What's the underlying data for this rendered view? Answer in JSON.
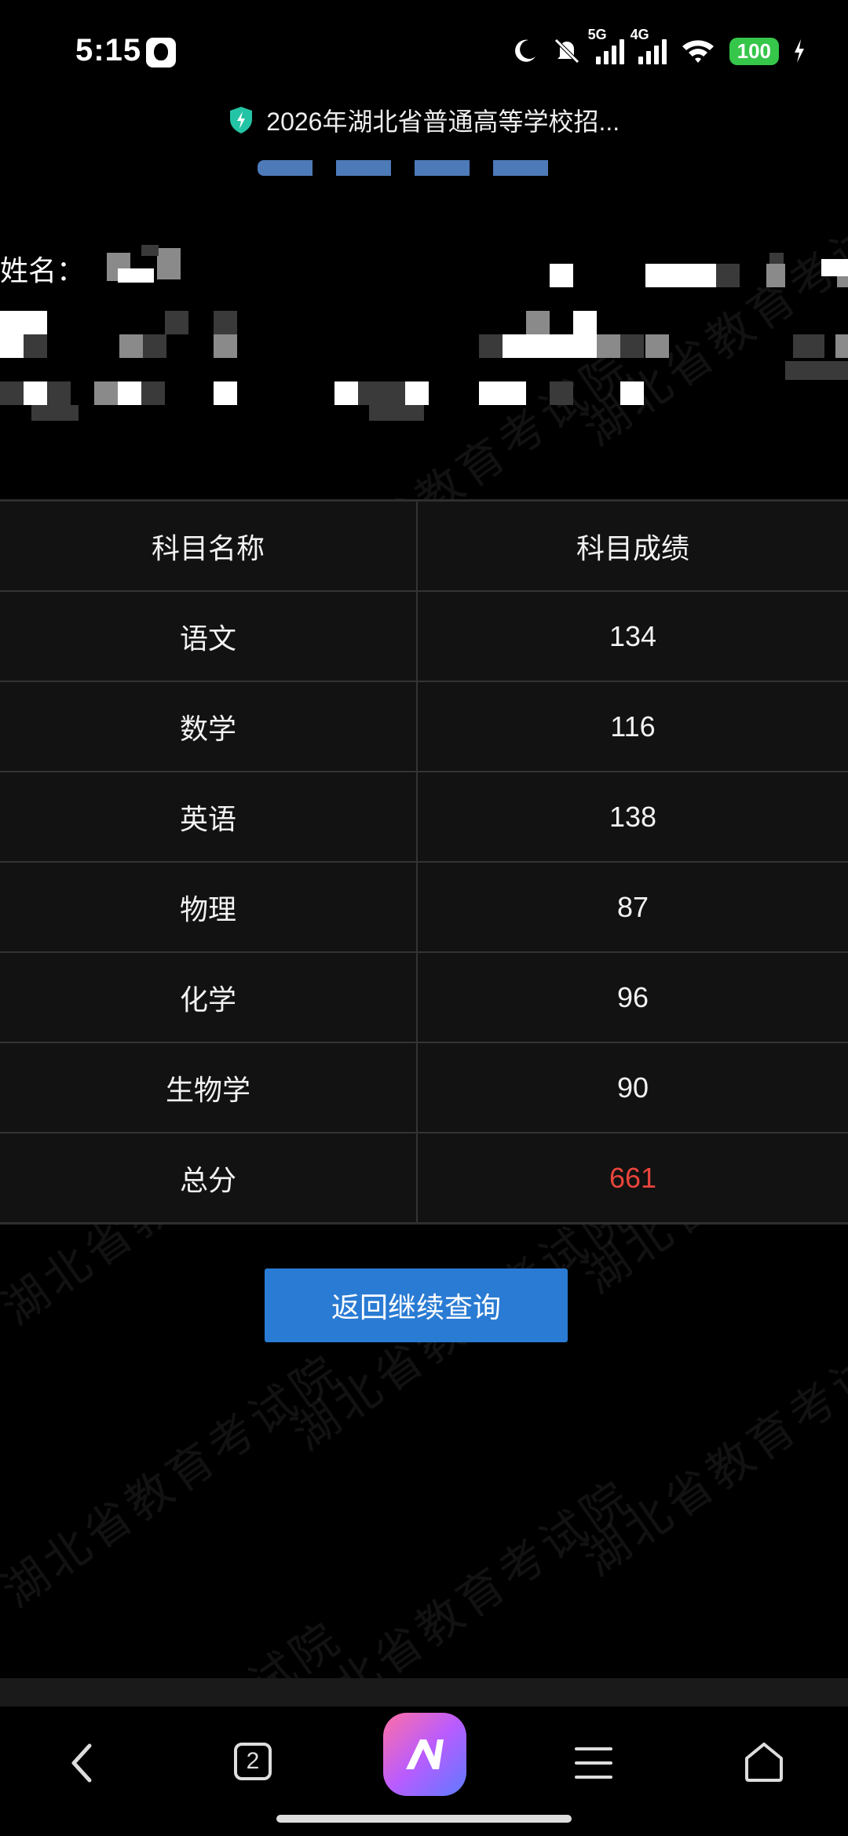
{
  "status_bar": {
    "time": "5:15",
    "net1": "5G",
    "net2": "4G",
    "battery": "100"
  },
  "browser": {
    "page_title": "2026年湖北省普通高等学校招..."
  },
  "candidate": {
    "name_label": "姓名："
  },
  "table": {
    "headers": [
      "科目名称",
      "科目成绩"
    ],
    "rows": [
      {
        "subject": "语文",
        "score": "134"
      },
      {
        "subject": "数学",
        "score": "116"
      },
      {
        "subject": "英语",
        "score": "138"
      },
      {
        "subject": "物理",
        "score": "87"
      },
      {
        "subject": "化学",
        "score": "96"
      },
      {
        "subject": "生物学",
        "score": "90"
      },
      {
        "subject": "总分",
        "score": "661"
      }
    ]
  },
  "actions": {
    "back_query_label": "返回继续查询"
  },
  "watermark": "湖北省教育考试院",
  "nav": {
    "tab_count": "2"
  },
  "colors": {
    "accent_button": "#2a7bd3",
    "total_score": "#e8453c",
    "battery": "#35c64a"
  }
}
